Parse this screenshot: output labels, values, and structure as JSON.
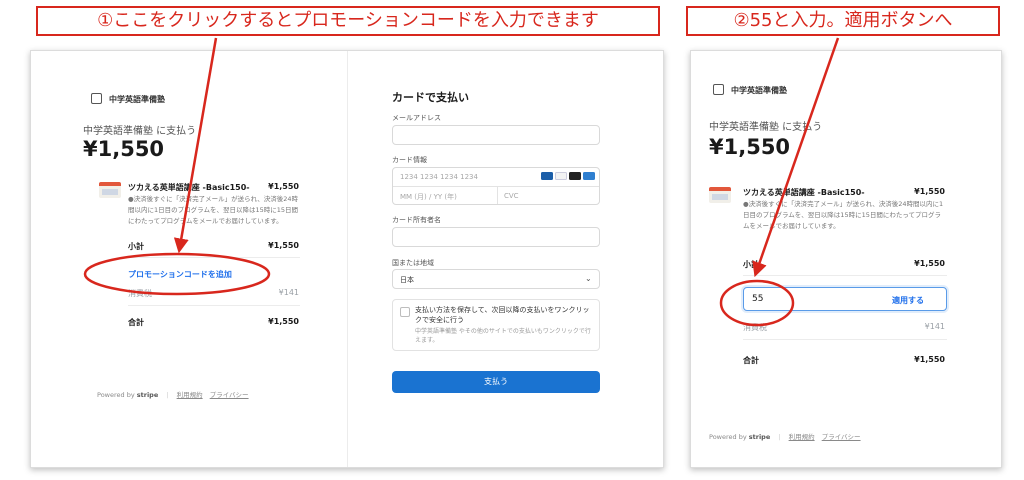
{
  "captions": {
    "step1": "①ここをクリックするとプロモーションコードを入力できます",
    "step2": "②55と入力。適用ボタンへ"
  },
  "summary": {
    "store_name": "中学英語準備塾",
    "pay_to": "中学英語準備塾 に支払う",
    "amount": "¥1,550",
    "product_name": "ツカえる英単語講座 -Basic150-",
    "product_price": "¥1,550",
    "product_desc": "●決済後すぐに「決済完了メール」が送られ、決済後24時間以内に1日目のプログラムを、翌日以降は15時に15日間にわたってプログラムをメールでお届けしています。",
    "subtotal_label": "小計",
    "subtotal_value": "¥1,550",
    "promo_link": "プロモーションコードを追加",
    "tax_label": "消費税",
    "tax_value": "¥141",
    "total_label": "合計",
    "total_value": "¥1,550"
  },
  "footer": {
    "powered_by": "Powered by",
    "brand": "stripe",
    "terms": "利用規約",
    "privacy": "プライバシー"
  },
  "payment_form": {
    "title": "カードで支払い",
    "email_label": "メールアドレス",
    "card_label": "カード情報",
    "card_number_placeholder": "1234 1234 1234 1234",
    "expiry_placeholder": "MM (月) / YY (年)",
    "cvc_placeholder": "CVC",
    "cardholder_label": "カード所有者名",
    "country_label": "国または地域",
    "country_value": "日本",
    "save_title": "支払い方法を保存して、次回以降の支払いをワンクリックで安全に行う",
    "save_sub": "中学英語準備塾 やその他のサイトでの支払いもワンクリックで行えます。",
    "pay_button": "支払う",
    "card_brands": [
      "JCB",
      "VISA",
      "Mastercard",
      "Amex"
    ]
  },
  "promo_entry": {
    "typed_value": "55",
    "apply_label": "適用する"
  },
  "colors": {
    "annotation": "#d8271d",
    "link": "#1f6feb",
    "pay_button": "#1a73d1"
  }
}
